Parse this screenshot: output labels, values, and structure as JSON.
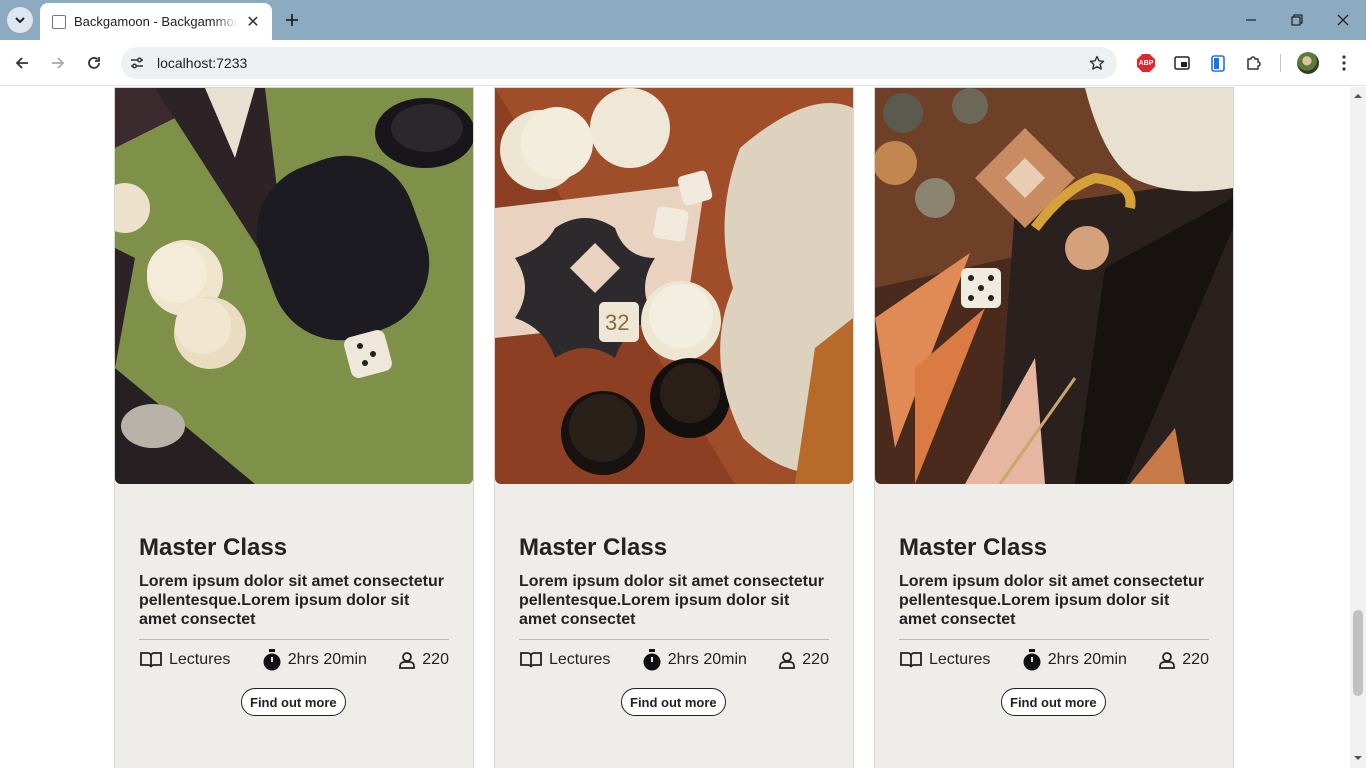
{
  "browser": {
    "tab_title": "Backgamoon - BackgammonW",
    "url": "localhost:7233",
    "extensions": [
      "adblock-plus-icon",
      "picture-in-picture-icon",
      "clipboard-icon",
      "puzzle-extensions-icon"
    ],
    "abp_label": "ABP"
  },
  "cards": [
    {
      "title": "Master Class",
      "description": "Lorem ipsum dolor sit amet consectetur pellentesque.Lorem ipsum dolor sit amet consectet",
      "lectures": "Lectures",
      "duration": "2hrs 20min",
      "students": "220",
      "button": "Find out more",
      "dice_label": ""
    },
    {
      "title": "Master Class",
      "description": "Lorem ipsum dolor sit amet consectetur pellentesque.Lorem ipsum dolor sit amet consectet",
      "lectures": "Lectures",
      "duration": "2hrs 20min",
      "students": "220",
      "button": "Find out more",
      "dice_label": "32"
    },
    {
      "title": "Master Class",
      "description": "Lorem ipsum dolor sit amet consectetur pellentesque.Lorem ipsum dolor sit amet consectet",
      "lectures": "Lectures",
      "duration": "2hrs 20min",
      "students": "220",
      "button": "Find out more",
      "dice_label": ""
    }
  ],
  "colors": {
    "tabbar": "#8cabc1",
    "card_bg": "#efedea",
    "text": "#222222"
  }
}
